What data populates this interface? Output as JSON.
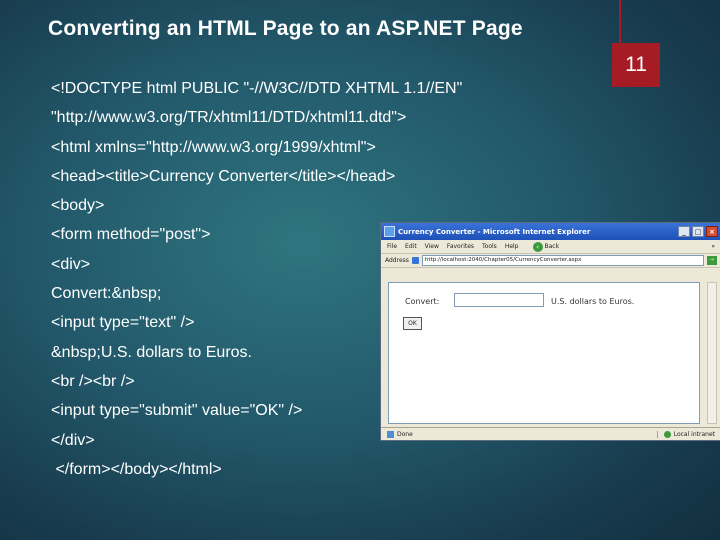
{
  "slide": {
    "title": "Converting an HTML Page to an ASP.NET Page",
    "number": "11"
  },
  "code_lines": [
    "<!DOCTYPE html PUBLIC \"-//W3C//DTD XHTML 1.1//EN\"",
    "\"http://www.w3.org/TR/xhtml11/DTD/xhtml11.dtd\">",
    "<html xmlns=\"http://www.w3.org/1999/xhtml\">",
    "<head><title>Currency Converter</title></head>",
    "<body>",
    "<form method=\"post\">",
    "<div>",
    "Convert:&nbsp;",
    "<input type=\"text\" />",
    "&nbsp;U.S. dollars to Euros.",
    "<br /><br />",
    "<input type=\"submit\" value=\"OK\" />",
    "</div>",
    " </form></body></html>"
  ],
  "browser": {
    "window_title": "Currency Converter - Microsoft Internet Explorer",
    "menu": {
      "file": "File",
      "edit": "Edit",
      "view": "View",
      "favorites": "Favorites",
      "tools": "Tools",
      "help": "Help",
      "back": "Back",
      "more": "»"
    },
    "address_label": "Address",
    "address_url": "http://localhost:2040/Chapter05/CurrencyConverter.aspx",
    "page": {
      "convert_label": "Convert:",
      "dollars_label": "U.S. dollars to Euros.",
      "ok_button": "OK"
    },
    "status": {
      "left": "Done",
      "zone": "Local intranet"
    }
  }
}
